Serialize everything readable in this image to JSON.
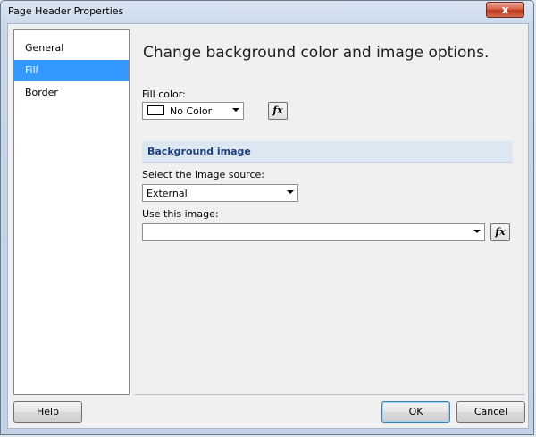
{
  "window": {
    "title": "Page Header Properties",
    "close_glyph": "x"
  },
  "nav": {
    "items": [
      {
        "label": "General",
        "selected": false
      },
      {
        "label": "Fill",
        "selected": true
      },
      {
        "label": "Border",
        "selected": false
      }
    ]
  },
  "main": {
    "heading": "Change background color and image options.",
    "fill_color_label": "Fill color:",
    "fill_color_value": "No Color",
    "fx_label": "fx",
    "section_title": "Background image",
    "image_source_label": "Select the image source:",
    "image_source_value": "External",
    "use_image_label": "Use this image:",
    "use_image_value": ""
  },
  "footer": {
    "help": "Help",
    "ok": "OK",
    "cancel": "Cancel"
  },
  "colors": {
    "selection": "#3399ff",
    "section_bg": "#dde7f2",
    "section_text": "#1b3f7a"
  }
}
